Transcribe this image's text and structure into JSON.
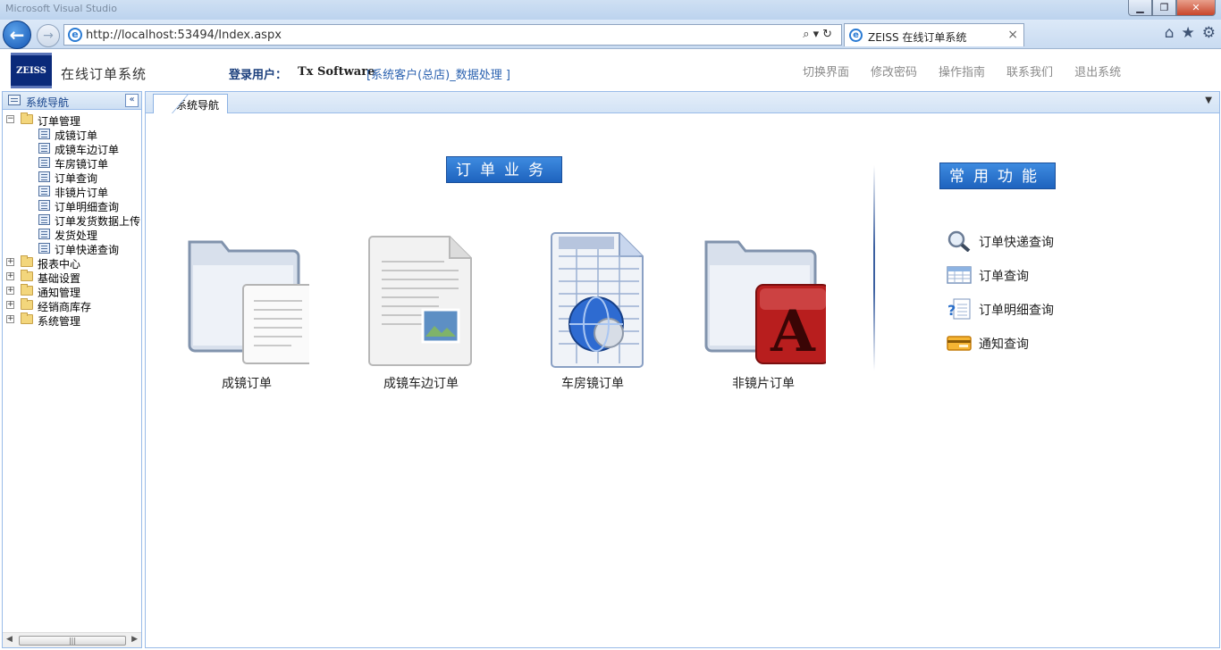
{
  "browser": {
    "window_title": "Microsoft Visual Studio",
    "url": "http://localhost:53494/Index.aspx",
    "tab_title": "ZEISS 在线订单系统"
  },
  "header": {
    "logo_text": "ZEISS",
    "system_title": "在线订单系统",
    "login_label": "登录用户：",
    "login_user": "Tx Software",
    "login_role": "[系统客户(总店)_数据处理 ]",
    "nav": [
      "切换界面",
      "修改密码",
      "操作指南",
      "联系我们",
      "退出系统"
    ]
  },
  "sidebar": {
    "title": "系统导航",
    "collapse_glyph": "«",
    "groups": [
      {
        "label": "订单管理",
        "expanded": true,
        "items": [
          "成镜订单",
          "成镜车边订单",
          "车房镜订单",
          "订单查询",
          "非镜片订单",
          "订单明细查询",
          "订单发货数据上传",
          "发货处理",
          "订单快递查询"
        ]
      },
      {
        "label": "报表中心",
        "expanded": false
      },
      {
        "label": "基础设置",
        "expanded": false
      },
      {
        "label": "通知管理",
        "expanded": false
      },
      {
        "label": "经销商库存",
        "expanded": false
      },
      {
        "label": "系统管理",
        "expanded": false
      }
    ]
  },
  "main": {
    "tab_label": "系统导航",
    "order_section_title": "订单业务",
    "common_section_title": "常用功能",
    "order_items": [
      {
        "label": "成镜订单",
        "icon": "folder-document-icon"
      },
      {
        "label": "成镜车边订单",
        "icon": "document-image-icon"
      },
      {
        "label": "车房镜订单",
        "icon": "spreadsheet-globe-icon"
      },
      {
        "label": "非镜片订单",
        "icon": "folder-red-a-icon"
      }
    ],
    "quick_items": [
      {
        "label": "订单快递查询",
        "icon": "magnifier-icon"
      },
      {
        "label": "订单查询",
        "icon": "table-icon"
      },
      {
        "label": "订单明细查询",
        "icon": "help-document-icon"
      },
      {
        "label": "通知查询",
        "icon": "card-icon"
      }
    ]
  },
  "colors": {
    "accent_blue": "#2a6fc9",
    "panel_border": "#99bbe8",
    "logo_navy": "#0a2a7a"
  }
}
